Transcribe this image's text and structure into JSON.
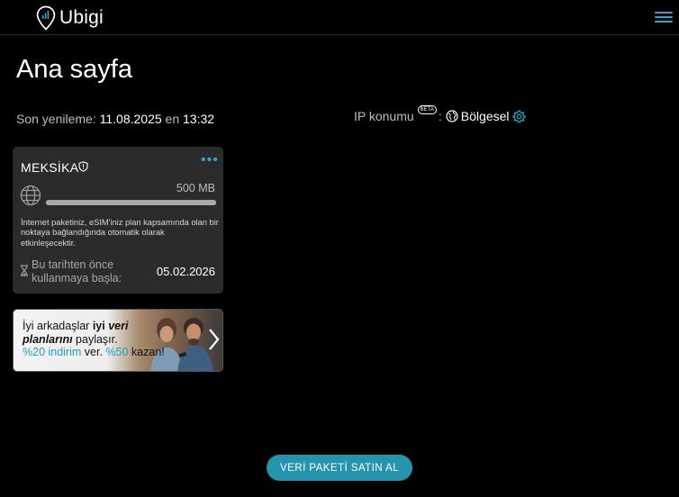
{
  "header": {
    "logo_text": "Ubigi",
    "menu_icon": "hamburger-menu-icon",
    "accent": "#2aa8c4"
  },
  "page": {
    "title": "Ana sayfa"
  },
  "refresh": {
    "label": "Son yenileme:",
    "date": "11.08.2025",
    "connector": "en",
    "time": "13:32"
  },
  "ip_location": {
    "label": "IP konumu",
    "badge": "BETA",
    "separator": ":",
    "value": "Bölgesel",
    "settings_icon": "gear-icon"
  },
  "plan": {
    "country": "MEKSİKA",
    "data_amount": "500 MB",
    "usage_fraction": 1.0,
    "info_text": "İnternet paketiniz, eSIM'iniz plan kapsamında olan bir noktaya bağlandığında otomatik olarak etkinleşecektir.",
    "start_label": "Bu tarihten önce kullanmaya başla:",
    "start_date": "05.02.2026"
  },
  "promo": {
    "line1_a": "İyi arkadaşlar ",
    "line1_b": "iyi ",
    "line1_c": "veri",
    "line2_a": "planlarını",
    "line2_b": " paylaşır.",
    "line3_a": "%20 indirim",
    "line3_b": " ver. ",
    "line3_c": "%50",
    "line3_d": " kazan!"
  },
  "cta": {
    "label": "VERİ PAKETİ SATIN AL",
    "color": "#2595ad"
  }
}
